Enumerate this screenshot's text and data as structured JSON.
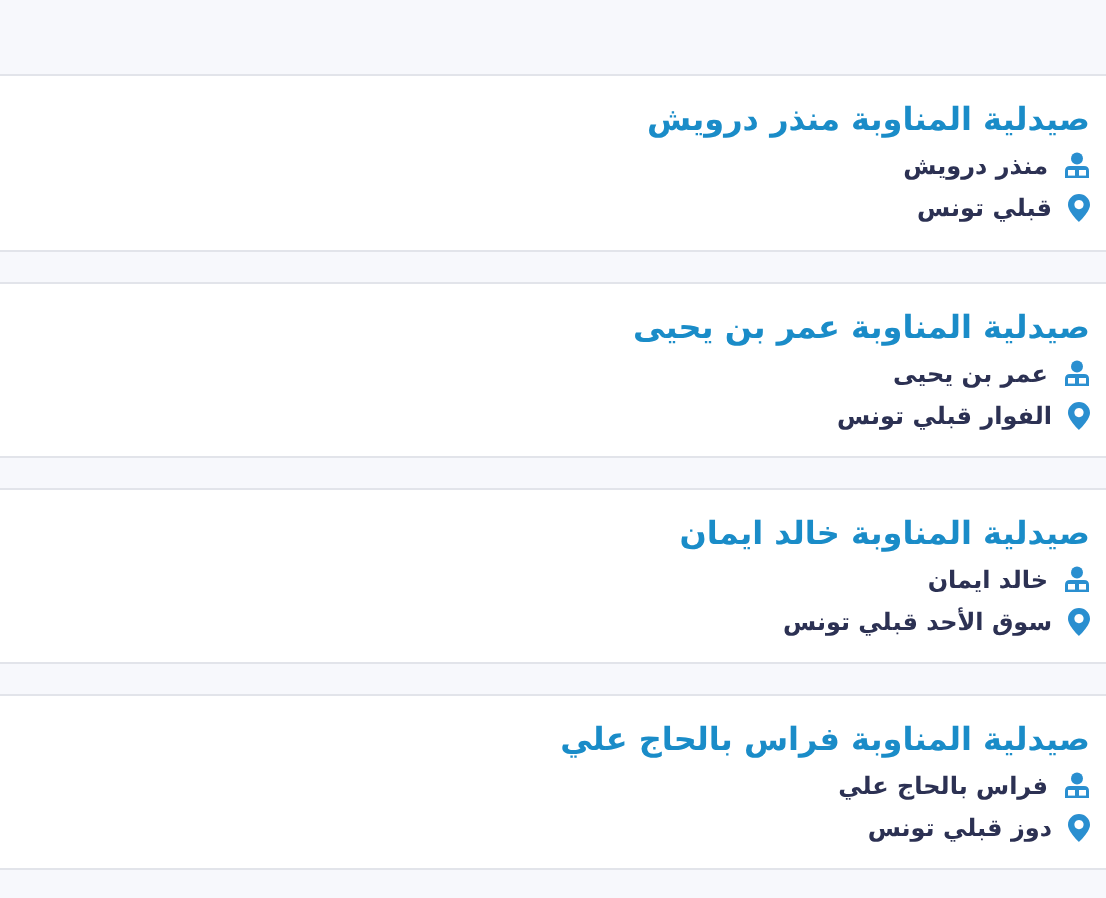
{
  "pharmacies": [
    {
      "name": "صيدلية المناوبة منذر درويش",
      "owner": "منذر درويش",
      "address": "قبلي تونس"
    },
    {
      "name": "صيدلية المناوبة عمر بن يحيى",
      "owner": "عمر بن يحيى",
      "address": "الفوار قبلي تونس"
    },
    {
      "name": "صيدلية المناوبة خالد ايمان",
      "owner": "خالد ايمان",
      "address": "سوق الأحد قبلي تونس"
    },
    {
      "name": "صيدلية المناوبة فراس بالحاج علي",
      "owner": "فراس بالحاج علي",
      "address": "دوز قبلي تونس"
    }
  ]
}
